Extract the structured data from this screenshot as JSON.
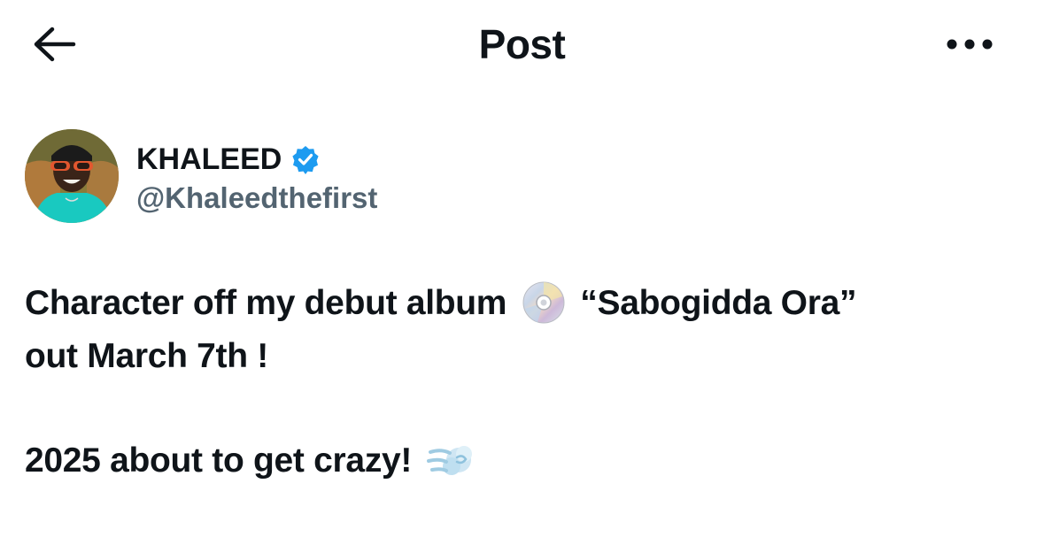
{
  "header": {
    "title": "Post",
    "back_icon": "arrow-left-icon",
    "more_icon": "ellipsis-horizontal-icon"
  },
  "author": {
    "display_name": "KHALEED",
    "handle": "@Khaleedthefirst",
    "verified": true,
    "verified_color": "#1d9bf0"
  },
  "post": {
    "line1_text": "Character off my debut album",
    "line1_emoji": "optical-disc-emoji",
    "line1_suffix": "“Sabogidda Ora”",
    "line2_text": "out March 7th !",
    "line3_text": "2025 about to get crazy!",
    "line3_emoji": "dashing-away-emoji"
  },
  "colors": {
    "text_primary": "#0f1419",
    "text_secondary": "#536471",
    "background": "#ffffff"
  }
}
